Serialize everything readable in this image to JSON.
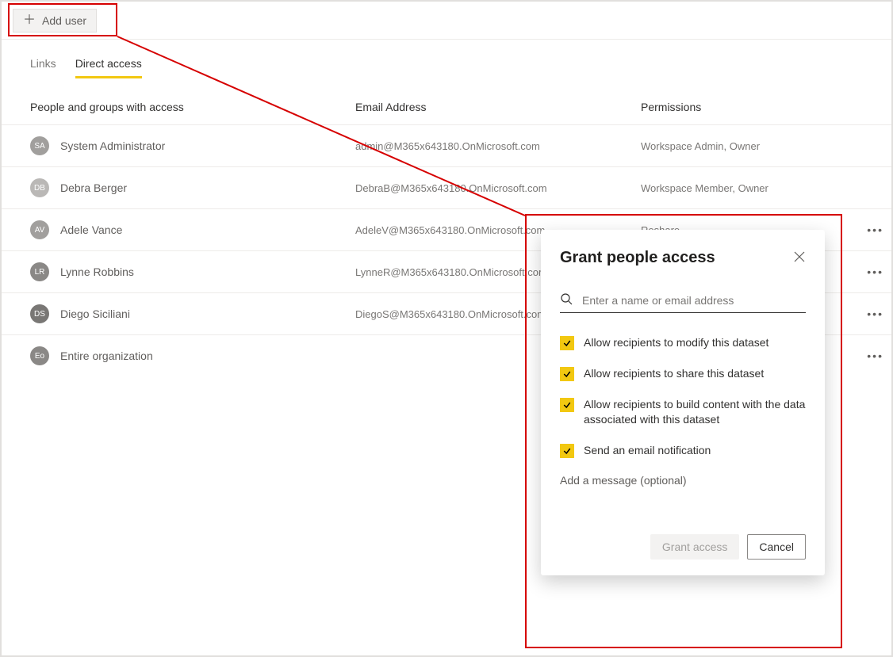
{
  "toolbar": {
    "add_user_label": "Add user"
  },
  "tabs": {
    "links": "Links",
    "direct_access": "Direct access"
  },
  "table": {
    "header_people": "People and groups with access",
    "header_email": "Email Address",
    "header_permissions": "Permissions",
    "rows": [
      {
        "initials": "SA",
        "avatar_color": "#a19f9d",
        "name": "System Administrator",
        "email": "admin@M365x643180.OnMicrosoft.com",
        "permissions": "Workspace Admin, Owner",
        "show_more": false
      },
      {
        "initials": "DB",
        "avatar_color": "#bab8b6",
        "name": "Debra Berger",
        "email": "DebraB@M365x643180.OnMicrosoft.com",
        "permissions": "Workspace Member, Owner",
        "show_more": false
      },
      {
        "initials": "AV",
        "avatar_color": "#a19f9d",
        "name": "Adele Vance",
        "email": "AdeleV@M365x643180.OnMicrosoft.com",
        "permissions": "Reshare",
        "show_more": true
      },
      {
        "initials": "LR",
        "avatar_color": "#8a8886",
        "name": "Lynne Robbins",
        "email": "LynneR@M365x643180.OnMicrosoft.com",
        "permissions": "",
        "show_more": true
      },
      {
        "initials": "DS",
        "avatar_color": "#797775",
        "name": "Diego Siciliani",
        "email": "DiegoS@M365x643180.OnMicrosoft.com",
        "permissions": "",
        "show_more": true
      },
      {
        "initials": "Eo",
        "avatar_color": "#8a8886",
        "name": "Entire organization",
        "email": "",
        "permissions": "",
        "show_more": true
      }
    ]
  },
  "dialog": {
    "title": "Grant people access",
    "search_placeholder": "Enter a name or email address",
    "checks": [
      "Allow recipients to modify this dataset",
      "Allow recipients to share this dataset",
      "Allow recipients to build content with the data associated with this dataset",
      "Send an email notification"
    ],
    "message_placeholder": "Add a message (optional)",
    "grant_label": "Grant access",
    "cancel_label": "Cancel"
  }
}
